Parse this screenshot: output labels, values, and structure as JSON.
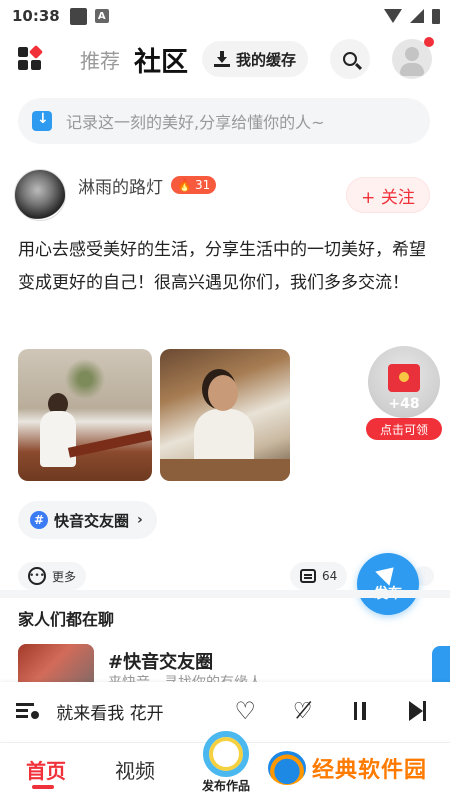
{
  "status_bar": {
    "time": "10:38",
    "app_letter": "A"
  },
  "header": {
    "tab_recommend": "推荐",
    "tab_community": "社区",
    "cache_button": "我的缓存"
  },
  "compose": {
    "placeholder": "记录这一刻的美好,分享给懂你的人~"
  },
  "post": {
    "author": "淋雨的路灯",
    "level": "31",
    "follow_label": "+ 关注",
    "text": "用心去感受美好的生活，分享生活中的一切美好，希望变成更好的自己！很高兴遇见你们，我们多多交流！",
    "topic": "快音交友圈",
    "more_label": "更多",
    "comment_count": "64"
  },
  "reward": {
    "amount": "+48",
    "claim_label": "点击可领"
  },
  "publish_fab": {
    "label": "发布"
  },
  "chat_section": {
    "title": "家人们都在聊",
    "item_title": "#快音交友圈",
    "item_subtitle": "来快音，寻找你的有缘人"
  },
  "player": {
    "song_title": "就来看我    花开"
  },
  "bottom_nav": {
    "home": "首页",
    "video": "视频",
    "publish": "发布作品"
  },
  "watermark": {
    "text": "经典软件园"
  },
  "colors": {
    "accent_red": "#f0313a",
    "accent_blue": "#2e9bf0"
  },
  "icons": [
    "grid-icon",
    "download-icon",
    "search-icon",
    "avatar-icon",
    "fire-icon",
    "hash-icon",
    "more-dots-icon",
    "comment-icon",
    "paper-plane-icon",
    "playlist-icon",
    "heart-icon",
    "broken-heart-icon",
    "pause-icon",
    "next-icon"
  ]
}
